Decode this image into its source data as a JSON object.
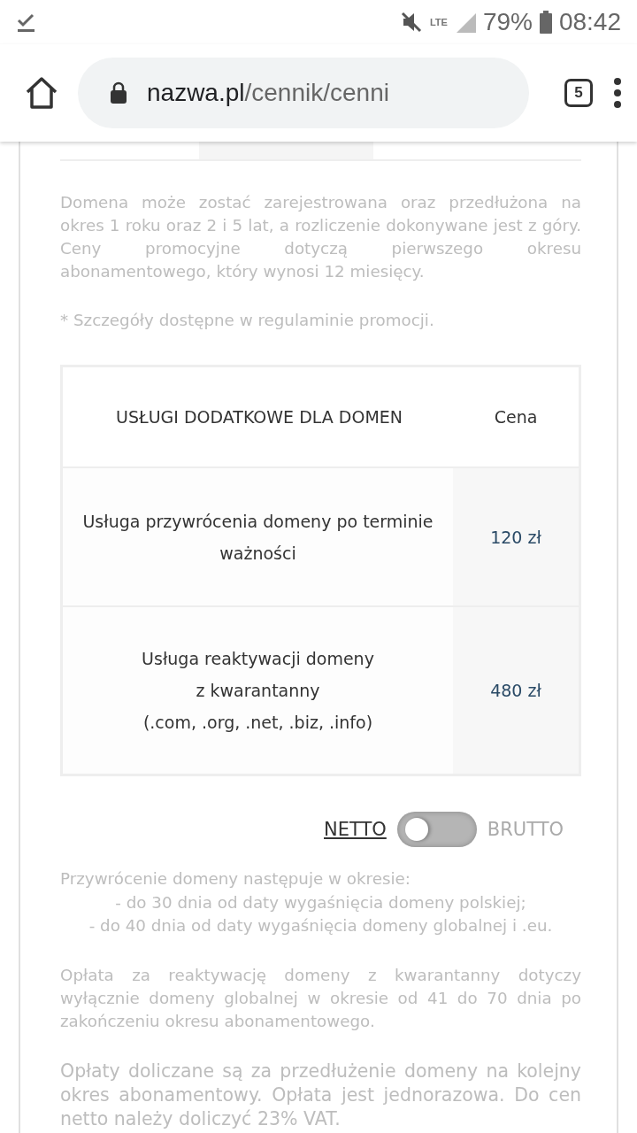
{
  "status_bar": {
    "battery": "79%",
    "time": "08:42",
    "network": "LTE"
  },
  "browser": {
    "url_host": "nazwa.pl",
    "url_path": "/cennik/cenni",
    "tab_count": "5"
  },
  "intro_paragraphs": [
    "Domena może zostać zarejestrowana oraz przedłużona na okres 1 roku oraz 2 i 5 lat, a rozliczenie dokonywane jest z góry. Ceny promocyjne dotyczą pierwszego okresu abonamentowego, który wynosi 12 miesięcy.",
    "* Szczegóły dostępne w regulaminie promocji."
  ],
  "table": {
    "columns": [
      "USŁUGI DODATKOWE DLA DOMEN",
      "Cena"
    ],
    "rows": [
      {
        "service": [
          "Usługa przywrócenia domeny po terminie ważności"
        ],
        "price": "120 zł"
      },
      {
        "service": [
          "Usługa reaktywacji domeny",
          "z kwarantanny",
          "(.com, .org, .net, .biz, .info)"
        ],
        "price": "480 zł"
      }
    ]
  },
  "price_toggle": {
    "left_label": "NETTO",
    "right_label": "BRUTTO",
    "on": false
  },
  "restore_note": {
    "title": "Przywrócenie domeny następuje w okresie:",
    "items": [
      "- do 30 dnia od daty wygaśnięcia domeny polskiej;",
      "- do 40 dnia od daty wygaśnięcia domeny globalnej i .eu."
    ]
  },
  "footer_paragraphs": [
    "Opłata za reaktywację domeny z kwarantanny dotyczy wyłącznie domeny globalnej w okresie od 41 do 70 dnia po zakończeniu okresu abonamentowego.",
    "Opłaty doliczane są za przedłużenie domeny na kolejny okres abonamentowy. Opłata jest jednorazowa. Do cen netto należy doliczyć 23% VAT."
  ]
}
